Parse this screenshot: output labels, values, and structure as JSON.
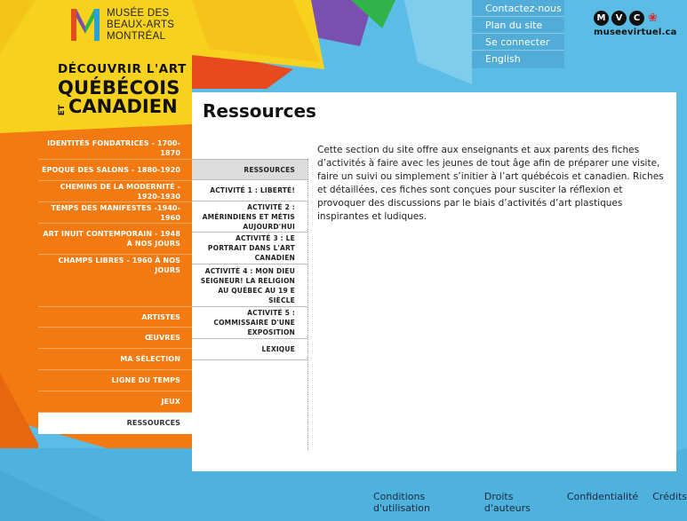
{
  "utility_menu": [
    "Contactez-nous",
    "Plan du site",
    "Se connecter",
    "English"
  ],
  "mvc": {
    "letters": [
      "M",
      "V",
      "C"
    ],
    "site": "museevirtuel.ca"
  },
  "museum_logo": [
    "MUSÉE DES",
    "BEAUX-ARTS",
    "MONTRÉAL"
  ],
  "site_title": {
    "line1": "DÉCOUVRIR L'ART",
    "line2": "QUÉBÉCOIS",
    "et": "ET",
    "line3": "CANADIEN"
  },
  "main_nav": {
    "periods": [
      "IDENTITÉS FONDATRICES - 1700-1870",
      "ÉPOQUE DES SALONS - 1880-1920",
      "CHEMINS DE LA MODERNITÉ - 1920-1930",
      "TEMPS DES MANIFESTES -1940-1960",
      "ART INUIT CONTEMPORAIN - 1948 À NOS JOURS",
      "CHAMPS LIBRES - 1960 À NOS JOURS"
    ],
    "sections": [
      "ARTISTES",
      "ŒUVRES",
      "MA SÉLECTION",
      "LIGNE DU TEMPS",
      "JEUX",
      "RESSOURCES"
    ],
    "active": "RESSOURCES"
  },
  "page_title": "Ressources",
  "sub_nav": [
    "RESSOURCES",
    "ACTIVITÉ 1 : LIBERTÉ!",
    "ACTIVITÉ 2 : AMÉRINDIENS ET MÉTIS AUJOURD'HUI",
    "ACTIVITÉ 3 : LE PORTRAIT DANS L'ART CANADIEN",
    "ACTIVITÉ 4 : MON DIEU SEIGNEUR! LA RELIGION AU QUÉBEC AU 19 E SIÈCLE",
    "ACTIVITÉ 5 : COMMISSAIRE D'UNE EXPOSITION",
    "LEXIQUE"
  ],
  "intro_text": "Cette section du site offre aux enseignants et aux parents des fiches d’activités à faire avec les jeunes de tout âge afin de préparer une visite, faire un suivi ou simplement s’initier à l’art québécois et canadien. Riches et détaillées, ces fiches sont conçues pour susciter la réflexion et provoquer des discussions par le biais d’activités d’art plastiques inspirantes et ludiques.",
  "footer": [
    "Conditions d'utilisation",
    "Droits d'auteurs",
    "Confidentialité",
    "Crédits"
  ],
  "colors": {
    "sky": "#5bbde6",
    "yellow": "#f6d21f",
    "orange": "#f27a10",
    "red": "#e64a1e",
    "purple": "#7b4fb0",
    "green": "#2fb34a",
    "panel": "#ffffff"
  }
}
